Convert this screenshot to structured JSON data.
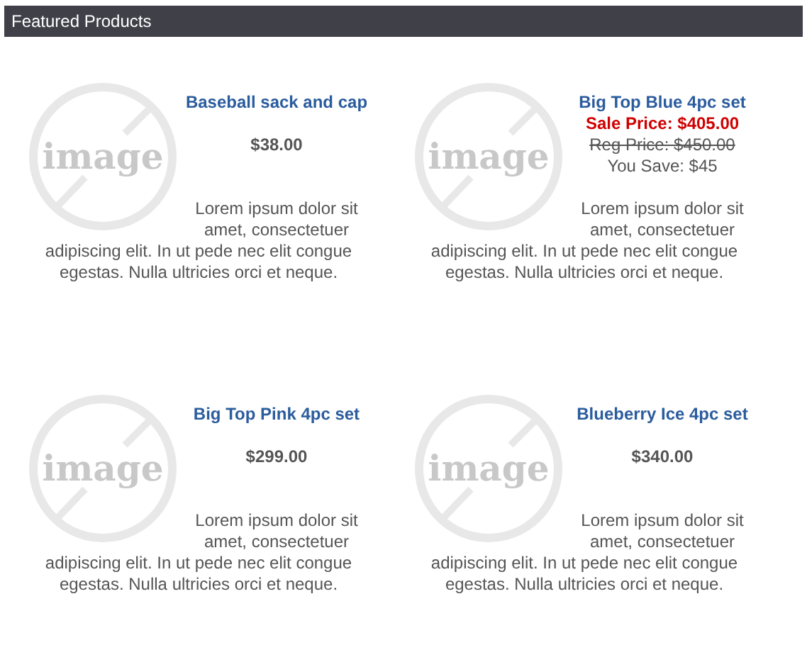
{
  "header": {
    "title": "Featured Products"
  },
  "products": [
    {
      "kind": "regular",
      "image_label": "image",
      "name": "Baseball sack and cap",
      "price": "$38.00",
      "description": "Lorem ipsum dolor sit amet, consectetuer adipiscing elit. In ut pede nec elit congue egestas. Nulla ultricies orci et neque."
    },
    {
      "kind": "sale",
      "image_label": "image",
      "name": "Big Top Blue 4pc set",
      "sale_price": "Sale Price: $405.00",
      "reg_price": "Reg Price: $450.00",
      "savings": "You Save: $45",
      "description": "Lorem ipsum dolor sit amet, consectetuer adipiscing elit. In ut pede nec elit congue egestas. Nulla ultricies orci et neque."
    },
    {
      "kind": "regular",
      "image_label": "image",
      "name": "Big Top Pink 4pc set",
      "price": "$299.00",
      "description": "Lorem ipsum dolor sit amet, consectetuer adipiscing elit. In ut pede nec elit congue egestas. Nulla ultricies orci et neque."
    },
    {
      "kind": "regular",
      "image_label": "image",
      "name": "Blueberry Ice 4pc set",
      "price": "$340.00",
      "description": "Lorem ipsum dolor sit amet, consectetuer adipiscing elit. In ut pede nec elit congue egestas. Nulla ultricies orci et neque."
    }
  ]
}
